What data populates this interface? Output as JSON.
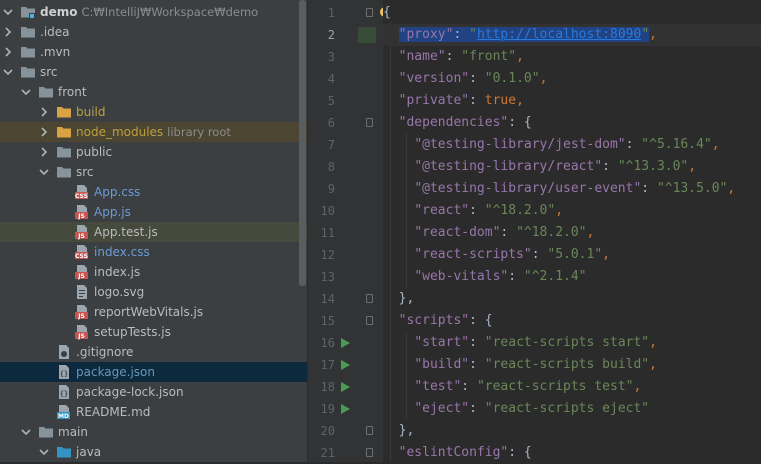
{
  "tree": {
    "rows": [
      {
        "label": "demo",
        "extra": "C:₩IntelliJ₩Workspace₩demo",
        "level": 0,
        "arrow": "down",
        "icon": "folder-module",
        "style": "bold",
        "highlight": ""
      },
      {
        "label": ".idea",
        "extra": "",
        "level": 0,
        "arrow": "right",
        "icon": "folder",
        "style": "",
        "highlight": ""
      },
      {
        "label": ".mvn",
        "extra": "",
        "level": 0,
        "arrow": "right",
        "icon": "folder",
        "style": "",
        "highlight": ""
      },
      {
        "label": "src",
        "extra": "",
        "level": 0,
        "arrow": "down",
        "icon": "folder",
        "style": "",
        "highlight": ""
      },
      {
        "label": "front",
        "extra": "",
        "level": 1,
        "arrow": "down",
        "icon": "folder",
        "style": "",
        "highlight": ""
      },
      {
        "label": "build",
        "extra": "",
        "level": 2,
        "arrow": "right",
        "icon": "folder-yellow",
        "style": "yellow",
        "highlight": ""
      },
      {
        "label": "node_modules",
        "extra": "library root",
        "level": 2,
        "arrow": "right",
        "icon": "folder-yellow",
        "style": "yellow",
        "highlight": "nm"
      },
      {
        "label": "public",
        "extra": "",
        "level": 2,
        "arrow": "right",
        "icon": "folder",
        "style": "",
        "highlight": ""
      },
      {
        "label": "src",
        "extra": "",
        "level": 2,
        "arrow": "down",
        "icon": "folder",
        "style": "",
        "highlight": ""
      },
      {
        "label": "App.css",
        "extra": "",
        "level": 3,
        "arrow": "none",
        "icon": "css",
        "style": "blue",
        "highlight": ""
      },
      {
        "label": "App.js",
        "extra": "",
        "level": 3,
        "arrow": "none",
        "icon": "js",
        "style": "blue",
        "highlight": ""
      },
      {
        "label": "App.test.js",
        "extra": "",
        "level": 3,
        "arrow": "none",
        "icon": "js",
        "style": "",
        "highlight": "test"
      },
      {
        "label": "index.css",
        "extra": "",
        "level": 3,
        "arrow": "none",
        "icon": "css",
        "style": "blue",
        "highlight": ""
      },
      {
        "label": "index.js",
        "extra": "",
        "level": 3,
        "arrow": "none",
        "icon": "js",
        "style": "",
        "highlight": ""
      },
      {
        "label": "logo.svg",
        "extra": "",
        "level": 3,
        "arrow": "none",
        "icon": "text",
        "style": "",
        "highlight": ""
      },
      {
        "label": "reportWebVitals.js",
        "extra": "",
        "level": 3,
        "arrow": "none",
        "icon": "js",
        "style": "",
        "highlight": ""
      },
      {
        "label": "setupTests.js",
        "extra": "",
        "level": 3,
        "arrow": "none",
        "icon": "js",
        "style": "",
        "highlight": ""
      },
      {
        "label": ".gitignore",
        "extra": "",
        "level": 2,
        "arrow": "none",
        "icon": "gitignore",
        "style": "",
        "highlight": ""
      },
      {
        "label": "package.json",
        "extra": "",
        "level": 2,
        "arrow": "none",
        "icon": "json",
        "style": "cyan",
        "highlight": "sel"
      },
      {
        "label": "package-lock.json",
        "extra": "",
        "level": 2,
        "arrow": "none",
        "icon": "json",
        "style": "",
        "highlight": ""
      },
      {
        "label": "README.md",
        "extra": "",
        "level": 2,
        "arrow": "none",
        "icon": "md",
        "style": "",
        "highlight": ""
      },
      {
        "label": "main",
        "extra": "",
        "level": 1,
        "arrow": "down",
        "icon": "folder",
        "style": "",
        "highlight": ""
      },
      {
        "label": "java",
        "extra": "",
        "level": 2,
        "arrow": "down",
        "icon": "folder-blue",
        "style": "",
        "highlight": ""
      }
    ]
  },
  "editor": {
    "current_line": 2,
    "lines": [
      {
        "n": "1",
        "run": false,
        "fold": true,
        "tokens": [
          {
            "t": "{",
            "c": "plain"
          }
        ]
      },
      {
        "n": "2",
        "run": false,
        "fold": false,
        "tokens": [
          {
            "t": "  ",
            "c": "plain"
          },
          {
            "t": "\"proxy\"",
            "c": "key sel-text"
          },
          {
            "t": ": ",
            "c": "plain sel-text"
          },
          {
            "t": "\"",
            "c": "str sel-text"
          },
          {
            "t": "http://localhost:8090",
            "c": "url sel-text"
          },
          {
            "t": "\"",
            "c": "str sel-text"
          },
          {
            "t": ",",
            "c": "punc"
          }
        ]
      },
      {
        "n": "3",
        "run": false,
        "fold": false,
        "tokens": [
          {
            "t": "  ",
            "c": "plain"
          },
          {
            "t": "\"name\"",
            "c": "key"
          },
          {
            "t": ": ",
            "c": "plain"
          },
          {
            "t": "\"front\"",
            "c": "str"
          },
          {
            "t": ",",
            "c": "punc"
          }
        ]
      },
      {
        "n": "4",
        "run": false,
        "fold": false,
        "tokens": [
          {
            "t": "  ",
            "c": "plain"
          },
          {
            "t": "\"version\"",
            "c": "key"
          },
          {
            "t": ": ",
            "c": "plain"
          },
          {
            "t": "\"0.1.0\"",
            "c": "str"
          },
          {
            "t": ",",
            "c": "punc"
          }
        ]
      },
      {
        "n": "5",
        "run": false,
        "fold": false,
        "tokens": [
          {
            "t": "  ",
            "c": "plain"
          },
          {
            "t": "\"private\"",
            "c": "key"
          },
          {
            "t": ": ",
            "c": "plain"
          },
          {
            "t": "true",
            "c": "kw"
          },
          {
            "t": ",",
            "c": "punc"
          }
        ]
      },
      {
        "n": "6",
        "run": false,
        "fold": true,
        "tokens": [
          {
            "t": "  ",
            "c": "plain"
          },
          {
            "t": "\"dependencies\"",
            "c": "key"
          },
          {
            "t": ": {",
            "c": "plain"
          }
        ]
      },
      {
        "n": "7",
        "run": false,
        "fold": false,
        "tokens": [
          {
            "t": "    ",
            "c": "plain"
          },
          {
            "t": "\"@testing-library/jest-dom\"",
            "c": "key"
          },
          {
            "t": ": ",
            "c": "plain"
          },
          {
            "t": "\"^5.16.4\"",
            "c": "str"
          },
          {
            "t": ",",
            "c": "punc"
          }
        ]
      },
      {
        "n": "8",
        "run": false,
        "fold": false,
        "tokens": [
          {
            "t": "    ",
            "c": "plain"
          },
          {
            "t": "\"@testing-library/react\"",
            "c": "key"
          },
          {
            "t": ": ",
            "c": "plain"
          },
          {
            "t": "\"^13.3.0\"",
            "c": "str"
          },
          {
            "t": ",",
            "c": "punc"
          }
        ]
      },
      {
        "n": "9",
        "run": false,
        "fold": false,
        "tokens": [
          {
            "t": "    ",
            "c": "plain"
          },
          {
            "t": "\"@testing-library/user-event\"",
            "c": "key"
          },
          {
            "t": ": ",
            "c": "plain"
          },
          {
            "t": "\"^13.5.0\"",
            "c": "str"
          },
          {
            "t": ",",
            "c": "punc"
          }
        ]
      },
      {
        "n": "10",
        "run": false,
        "fold": false,
        "tokens": [
          {
            "t": "    ",
            "c": "plain"
          },
          {
            "t": "\"react\"",
            "c": "key"
          },
          {
            "t": ": ",
            "c": "plain"
          },
          {
            "t": "\"^18.2.0\"",
            "c": "str"
          },
          {
            "t": ",",
            "c": "punc"
          }
        ]
      },
      {
        "n": "11",
        "run": false,
        "fold": false,
        "tokens": [
          {
            "t": "    ",
            "c": "plain"
          },
          {
            "t": "\"react-dom\"",
            "c": "key"
          },
          {
            "t": ": ",
            "c": "plain"
          },
          {
            "t": "\"^18.2.0\"",
            "c": "str"
          },
          {
            "t": ",",
            "c": "punc"
          }
        ]
      },
      {
        "n": "12",
        "run": false,
        "fold": false,
        "tokens": [
          {
            "t": "    ",
            "c": "plain"
          },
          {
            "t": "\"react-scripts\"",
            "c": "key"
          },
          {
            "t": ": ",
            "c": "plain"
          },
          {
            "t": "\"5.0.1\"",
            "c": "str"
          },
          {
            "t": ",",
            "c": "punc"
          }
        ]
      },
      {
        "n": "13",
        "run": false,
        "fold": false,
        "tokens": [
          {
            "t": "    ",
            "c": "plain"
          },
          {
            "t": "\"web-vitals\"",
            "c": "key"
          },
          {
            "t": ": ",
            "c": "plain"
          },
          {
            "t": "\"^2.1.4\"",
            "c": "str"
          }
        ]
      },
      {
        "n": "14",
        "run": false,
        "fold": true,
        "tokens": [
          {
            "t": "  },",
            "c": "plain"
          }
        ]
      },
      {
        "n": "15",
        "run": false,
        "fold": true,
        "tokens": [
          {
            "t": "  ",
            "c": "plain"
          },
          {
            "t": "\"scripts\"",
            "c": "key"
          },
          {
            "t": ": {",
            "c": "plain"
          }
        ]
      },
      {
        "n": "16",
        "run": true,
        "fold": false,
        "tokens": [
          {
            "t": "    ",
            "c": "plain"
          },
          {
            "t": "\"start\"",
            "c": "key"
          },
          {
            "t": ": ",
            "c": "plain"
          },
          {
            "t": "\"react-scripts start\"",
            "c": "str"
          },
          {
            "t": ",",
            "c": "punc"
          }
        ]
      },
      {
        "n": "17",
        "run": true,
        "fold": false,
        "tokens": [
          {
            "t": "    ",
            "c": "plain"
          },
          {
            "t": "\"build\"",
            "c": "key"
          },
          {
            "t": ": ",
            "c": "plain"
          },
          {
            "t": "\"react-scripts build\"",
            "c": "str"
          },
          {
            "t": ",",
            "c": "punc"
          }
        ]
      },
      {
        "n": "18",
        "run": true,
        "fold": false,
        "tokens": [
          {
            "t": "    ",
            "c": "plain"
          },
          {
            "t": "\"test\"",
            "c": "key"
          },
          {
            "t": ": ",
            "c": "plain"
          },
          {
            "t": "\"react-scripts test\"",
            "c": "str"
          },
          {
            "t": ",",
            "c": "punc"
          }
        ]
      },
      {
        "n": "19",
        "run": true,
        "fold": false,
        "tokens": [
          {
            "t": "    ",
            "c": "plain"
          },
          {
            "t": "\"eject\"",
            "c": "key"
          },
          {
            "t": ": ",
            "c": "plain"
          },
          {
            "t": "\"react-scripts eject\"",
            "c": "str"
          }
        ]
      },
      {
        "n": "20",
        "run": false,
        "fold": true,
        "tokens": [
          {
            "t": "  },",
            "c": "plain"
          }
        ]
      },
      {
        "n": "21",
        "run": false,
        "fold": true,
        "tokens": [
          {
            "t": "  ",
            "c": "plain"
          },
          {
            "t": "\"eslintConfig\"",
            "c": "key"
          },
          {
            "t": ": {",
            "c": "plain"
          }
        ]
      }
    ]
  },
  "colors": {
    "tree_bg": "#3c3f41",
    "editor_bg": "#2b2b2b",
    "gutter_bg": "#313335",
    "selection": "#0d293e",
    "json_key": "#9876aa",
    "json_string": "#6a8759",
    "json_keyword": "#cc7832",
    "url": "#287bde",
    "run_gutter": "#499c54"
  }
}
